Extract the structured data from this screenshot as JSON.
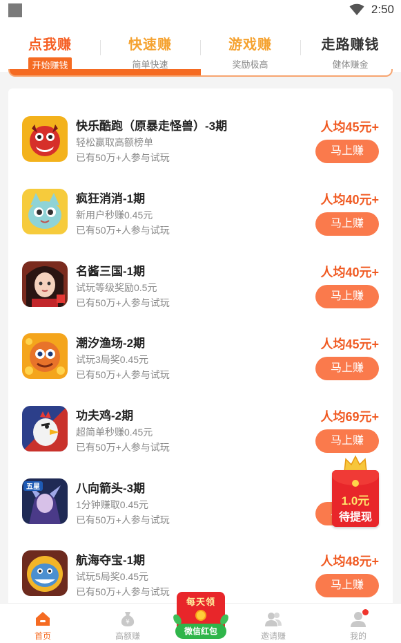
{
  "status_bar": {
    "time": "2:50"
  },
  "tabs": [
    {
      "title": "点我赚",
      "subtitle": "开始赚钱",
      "state": "active"
    },
    {
      "title": "快速赚",
      "subtitle": "简单快速",
      "state": "normal"
    },
    {
      "title": "游戏赚",
      "subtitle": "奖励极高",
      "state": "normal"
    },
    {
      "title": "走路赚钱",
      "subtitle": "健体赚金",
      "state": "plain"
    }
  ],
  "tab_progress": 0.5,
  "tasks": [
    {
      "title": "快乐酷跑（原暴走怪兽）-3期",
      "desc": "轻松赢取高额榜单",
      "participants": "已有50万+人参与试玩",
      "reward": "人均45元+",
      "button": "马上赚",
      "icon": "monster-game-icon"
    },
    {
      "title": "疯狂消消-1期",
      "desc": "新用户秒赚0.45元",
      "participants": "已有50万+人参与试玩",
      "reward": "人均40元+",
      "button": "马上赚",
      "icon": "cat-game-icon"
    },
    {
      "title": "名酱三国-1期",
      "desc": "试玩等级奖励0.5元",
      "participants": "已有50万+人参与试玩",
      "reward": "人均40元+",
      "button": "马上赚",
      "icon": "girl-game-icon"
    },
    {
      "title": "潮汐渔场-2期",
      "desc": "试玩3局奖0.45元",
      "participants": "已有50万+人参与试玩",
      "reward": "人均45元+",
      "button": "马上赚",
      "icon": "fish-game-icon"
    },
    {
      "title": "功夫鸡-2期",
      "desc": "超简单秒赚0.45元",
      "participants": "已有50万+人参与试玩",
      "reward": "人均69元+",
      "button": "马上赚",
      "icon": "chicken-game-icon"
    },
    {
      "title": "八向箭头-3期",
      "desc": "1分钟赚取0.45元",
      "participants": "已有50万+人参与试玩",
      "reward": "人均",
      "button": "马上赚",
      "icon": "warrior-game-icon"
    },
    {
      "title": "航海夺宝-1期",
      "desc": "试玩5局奖0.45元",
      "participants": "已有50万+人参与试玩",
      "reward": "人均48元+",
      "button": "马上赚",
      "icon": "shark-game-icon"
    }
  ],
  "icon_badges": {
    "warrior": "五星"
  },
  "float_packet": {
    "amount": "1.0元",
    "label": "待提现",
    "icon": "red-packet-icon"
  },
  "center_packet": {
    "top": "每天领",
    "bottom": "微信红包"
  },
  "bottom_nav": [
    {
      "label": "首页",
      "icon": "home-icon",
      "state": "active"
    },
    {
      "label": "高额赚",
      "icon": "money-bag-icon",
      "state": "normal"
    },
    {
      "label": "邀请赚",
      "icon": "people-icon",
      "state": "normal"
    },
    {
      "label": "我的",
      "icon": "user-icon",
      "state": "normal"
    }
  ],
  "colors": {
    "accent": "#f56b22",
    "button": "#fa7a4c",
    "reward": "#f05a22",
    "tab_secondary": "#f5a230",
    "nav_inactive": "#aaaaaa"
  }
}
